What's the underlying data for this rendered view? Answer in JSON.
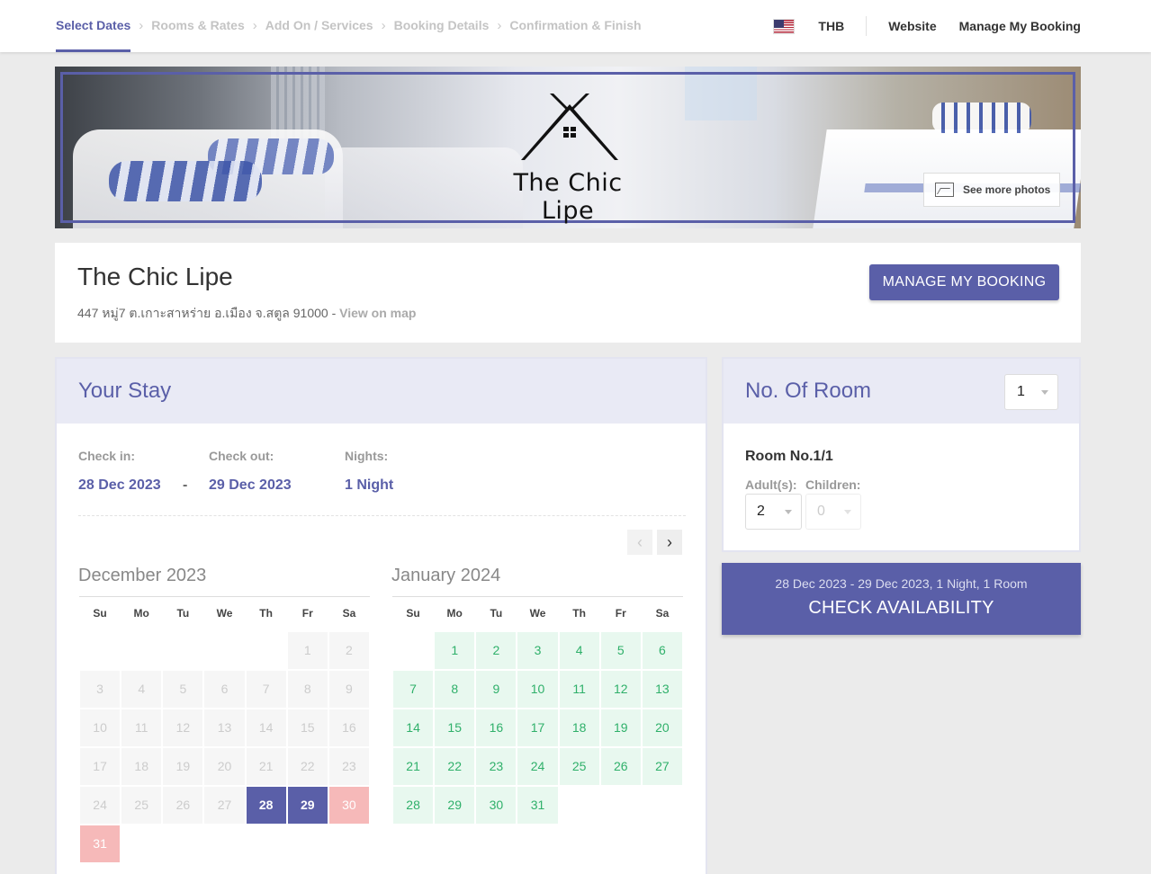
{
  "steps": [
    "Select Dates",
    "Rooms & Rates",
    "Add On / Services",
    "Booking Details",
    "Confirmation & Finish"
  ],
  "topbar": {
    "currency": "THB",
    "website": "Website",
    "manage": "Manage My Booking"
  },
  "banner": {
    "logo_text": "The Chic Lipe",
    "see_photos": "See more photos"
  },
  "hotel": {
    "name": "The Chic Lipe",
    "address": "447 หมู่7 ต.เกาะสาหร่าย อ.เมือง จ.สตูล 91000",
    "separator": "-",
    "map_link": "View on map",
    "manage_button": "MANAGE MY BOOKING"
  },
  "stay": {
    "title": "Your Stay",
    "checkin_label": "Check in:",
    "checkin_value": "28 Dec 2023",
    "dash": "-",
    "checkout_label": "Check out:",
    "checkout_value": "29 Dec 2023",
    "nights_label": "Nights:",
    "nights_value": "1 Night",
    "prev_icon": "‹",
    "next_icon": "›"
  },
  "weekdays": [
    "Su",
    "Mo",
    "Tu",
    "We",
    "Th",
    "Fr",
    "Sa"
  ],
  "months": [
    {
      "title": "December 2023",
      "weeks": [
        [
          {
            "d": "",
            "s": "empty"
          },
          {
            "d": "",
            "s": "empty"
          },
          {
            "d": "",
            "s": "empty"
          },
          {
            "d": "",
            "s": "empty"
          },
          {
            "d": "",
            "s": "empty"
          },
          {
            "d": "1",
            "s": "past"
          },
          {
            "d": "2",
            "s": "past"
          }
        ],
        [
          {
            "d": "3",
            "s": "past"
          },
          {
            "d": "4",
            "s": "past"
          },
          {
            "d": "5",
            "s": "past"
          },
          {
            "d": "6",
            "s": "past"
          },
          {
            "d": "7",
            "s": "past"
          },
          {
            "d": "8",
            "s": "past"
          },
          {
            "d": "9",
            "s": "past"
          }
        ],
        [
          {
            "d": "10",
            "s": "past"
          },
          {
            "d": "11",
            "s": "past"
          },
          {
            "d": "12",
            "s": "past"
          },
          {
            "d": "13",
            "s": "past"
          },
          {
            "d": "14",
            "s": "past"
          },
          {
            "d": "15",
            "s": "past"
          },
          {
            "d": "16",
            "s": "past"
          }
        ],
        [
          {
            "d": "17",
            "s": "past"
          },
          {
            "d": "18",
            "s": "past"
          },
          {
            "d": "19",
            "s": "past"
          },
          {
            "d": "20",
            "s": "past"
          },
          {
            "d": "21",
            "s": "past"
          },
          {
            "d": "22",
            "s": "past"
          },
          {
            "d": "23",
            "s": "past"
          }
        ],
        [
          {
            "d": "24",
            "s": "past"
          },
          {
            "d": "25",
            "s": "past"
          },
          {
            "d": "26",
            "s": "past"
          },
          {
            "d": "27",
            "s": "past"
          },
          {
            "d": "28",
            "s": "sel"
          },
          {
            "d": "29",
            "s": "sel"
          },
          {
            "d": "30",
            "s": "closed"
          }
        ],
        [
          {
            "d": "31",
            "s": "closed"
          },
          {
            "d": "",
            "s": "empty"
          },
          {
            "d": "",
            "s": "empty"
          },
          {
            "d": "",
            "s": "empty"
          },
          {
            "d": "",
            "s": "empty"
          },
          {
            "d": "",
            "s": "empty"
          },
          {
            "d": "",
            "s": "empty"
          }
        ]
      ]
    },
    {
      "title": "January 2024",
      "weeks": [
        [
          {
            "d": "",
            "s": "empty"
          },
          {
            "d": "1",
            "s": "avail"
          },
          {
            "d": "2",
            "s": "avail"
          },
          {
            "d": "3",
            "s": "avail"
          },
          {
            "d": "4",
            "s": "avail"
          },
          {
            "d": "5",
            "s": "avail"
          },
          {
            "d": "6",
            "s": "avail"
          }
        ],
        [
          {
            "d": "7",
            "s": "avail"
          },
          {
            "d": "8",
            "s": "avail"
          },
          {
            "d": "9",
            "s": "avail"
          },
          {
            "d": "10",
            "s": "avail"
          },
          {
            "d": "11",
            "s": "avail"
          },
          {
            "d": "12",
            "s": "avail"
          },
          {
            "d": "13",
            "s": "avail"
          }
        ],
        [
          {
            "d": "14",
            "s": "avail"
          },
          {
            "d": "15",
            "s": "avail"
          },
          {
            "d": "16",
            "s": "avail"
          },
          {
            "d": "17",
            "s": "avail"
          },
          {
            "d": "18",
            "s": "avail"
          },
          {
            "d": "19",
            "s": "avail"
          },
          {
            "d": "20",
            "s": "avail"
          }
        ],
        [
          {
            "d": "21",
            "s": "avail"
          },
          {
            "d": "22",
            "s": "avail"
          },
          {
            "d": "23",
            "s": "avail"
          },
          {
            "d": "24",
            "s": "avail"
          },
          {
            "d": "25",
            "s": "avail"
          },
          {
            "d": "26",
            "s": "avail"
          },
          {
            "d": "27",
            "s": "avail"
          }
        ],
        [
          {
            "d": "28",
            "s": "avail"
          },
          {
            "d": "29",
            "s": "avail"
          },
          {
            "d": "30",
            "s": "avail"
          },
          {
            "d": "31",
            "s": "avail"
          },
          {
            "d": "",
            "s": "empty"
          },
          {
            "d": "",
            "s": "empty"
          },
          {
            "d": "",
            "s": "empty"
          }
        ]
      ]
    }
  ],
  "rooms": {
    "title": "No. Of Room",
    "count": "1",
    "room_label": "Room No.1/1",
    "adults_label": "Adult(s):",
    "adults_value": "2",
    "children_label": "Children:",
    "children_value": "0"
  },
  "check": {
    "summary": "28 Dec 2023 - 29 Dec 2023,  1 Night,  1 Room",
    "button": "CHECK AVAILABILITY"
  },
  "colors": {
    "accent": "#5a5fa8",
    "available": "#2fb06a",
    "available_bg": "#e8f8ef",
    "closed_bg": "#f6b9b9"
  },
  "icons": {
    "flag": "us-flag-icon",
    "photos": "image-icon",
    "step_separator": "chevron-right-icon"
  }
}
